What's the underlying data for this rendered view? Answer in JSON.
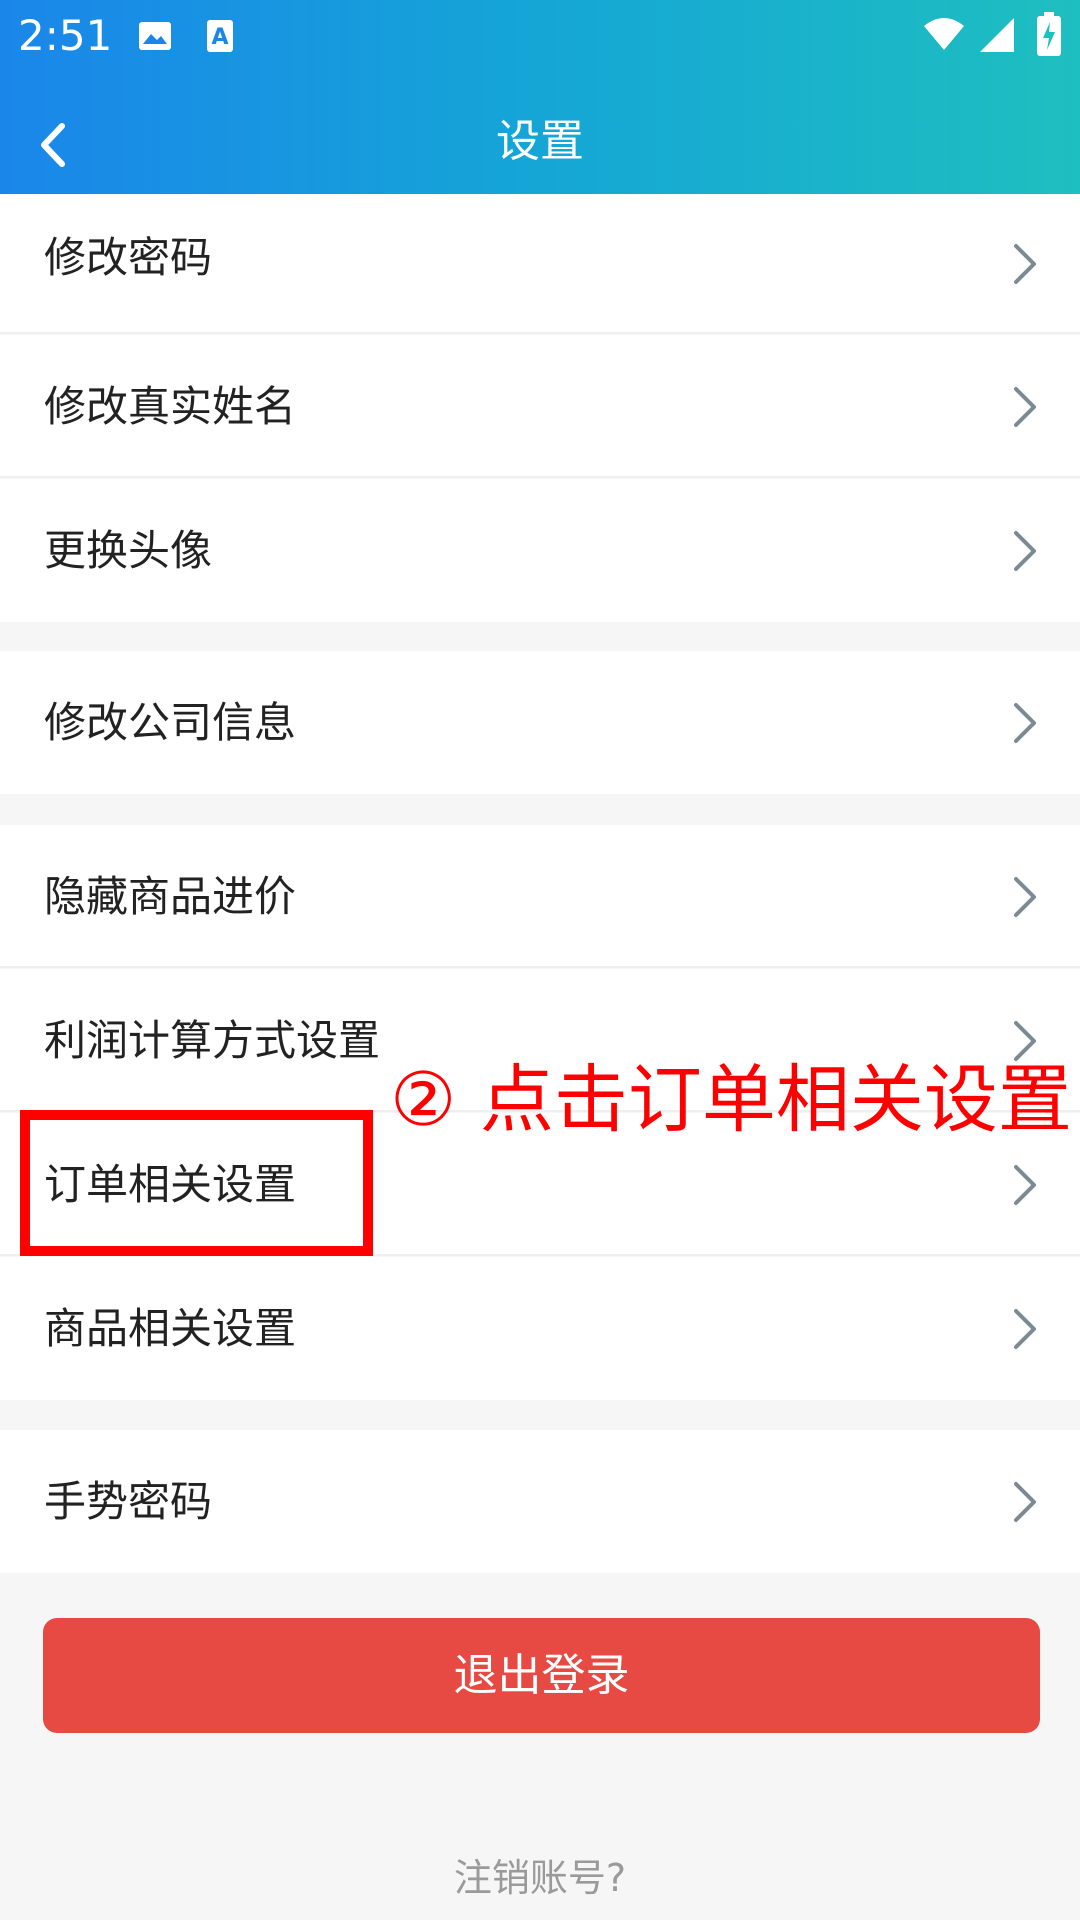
{
  "status_bar": {
    "time": "2:51",
    "icons": [
      "image-icon",
      "text-app-icon",
      "wifi-icon",
      "signal-icon",
      "battery-charging-icon"
    ]
  },
  "app_bar": {
    "title": "设置",
    "back_icon": "chevron-left-icon"
  },
  "settings": {
    "items": [
      {
        "label": "修改密码"
      },
      {
        "label": "修改真实姓名"
      },
      {
        "label": "更换头像"
      },
      {
        "label": "修改公司信息"
      },
      {
        "label": "隐藏商品进价"
      },
      {
        "label": "利润计算方式设置"
      },
      {
        "label": "订单相关设置"
      },
      {
        "label": "商品相关设置"
      },
      {
        "label": "手势密码"
      }
    ]
  },
  "annotation": {
    "text": "② 点击订单相关设置",
    "color": "#ff0000"
  },
  "logout": {
    "label": "退出登录",
    "color": "#e64a42"
  },
  "cancel_account": {
    "label": "注销账号?"
  },
  "colors": {
    "header_start": "#1a86ea",
    "header_end": "#1ebfc0",
    "background": "#f6f6f6"
  }
}
